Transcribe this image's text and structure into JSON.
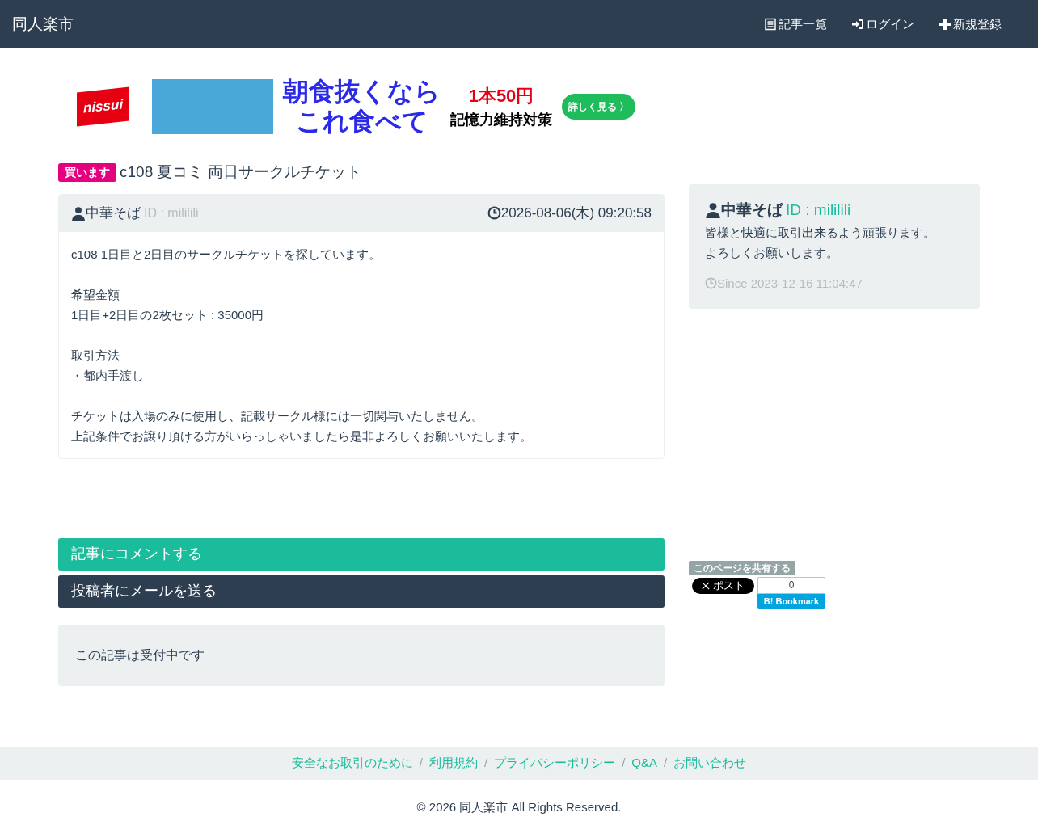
{
  "navbar": {
    "brand": "同人楽市",
    "links": [
      {
        "kind": "list",
        "label": "記事一覧"
      },
      {
        "kind": "login",
        "label": "ログイン"
      },
      {
        "kind": "signup",
        "label": "新規登録"
      }
    ]
  },
  "ad": {
    "logo": "nissui",
    "headline": [
      "朝食抜くなら",
      "これ食べて"
    ],
    "price": "1本50円",
    "tagline": "記憶力維持対策",
    "cta": "詳しく見る 〉"
  },
  "post": {
    "badge": "買います",
    "title": "c108 夏コミ 両日サークルチケット",
    "author": "中華そば",
    "author_id": "ID : mililili",
    "date": "2026-08-06(木) 09:20:58",
    "paragraphs": [
      [
        "c108 1日目と2日目のサークルチケットを探しています。"
      ],
      [
        "希望金額",
        "1日目+2日目の2枚セット : 35000円"
      ],
      [
        "取引方法",
        "・都内手渡し"
      ],
      [
        "チケットは入場のみに使用し、記載サークル様には一切関与いたしません。",
        "上記条件でお譲り頂ける方がいらっしゃいましたら是非よろしくお願いいたします。"
      ]
    ]
  },
  "actions": [
    {
      "kind": "comment",
      "label": "記事にコメントする"
    },
    {
      "kind": "mail",
      "label": "投稿者にメールを送る"
    }
  ],
  "status": "この記事は受付中です",
  "profile": {
    "name": "中華そば",
    "id": "ID : mililili",
    "bio": [
      "皆様と快適に取引出来るよう頑張ります。",
      "よろしくお願いします。"
    ],
    "since": "Since 2023-12-16 11:04:47"
  },
  "share": {
    "label": "このページを共有する",
    "post": "ポスト",
    "bookmark_count": "0",
    "bookmark_logo": "B!",
    "bookmark": "Bookmark"
  },
  "footer": {
    "links": [
      "安全なお取引のために",
      "利用規約",
      "プライバシーポリシー",
      "Q&A",
      "お問い合わせ"
    ],
    "separators": [
      "/",
      "/",
      "/",
      "/"
    ],
    "copyright": "© 2026 同人楽市 All Rights Reserved."
  }
}
